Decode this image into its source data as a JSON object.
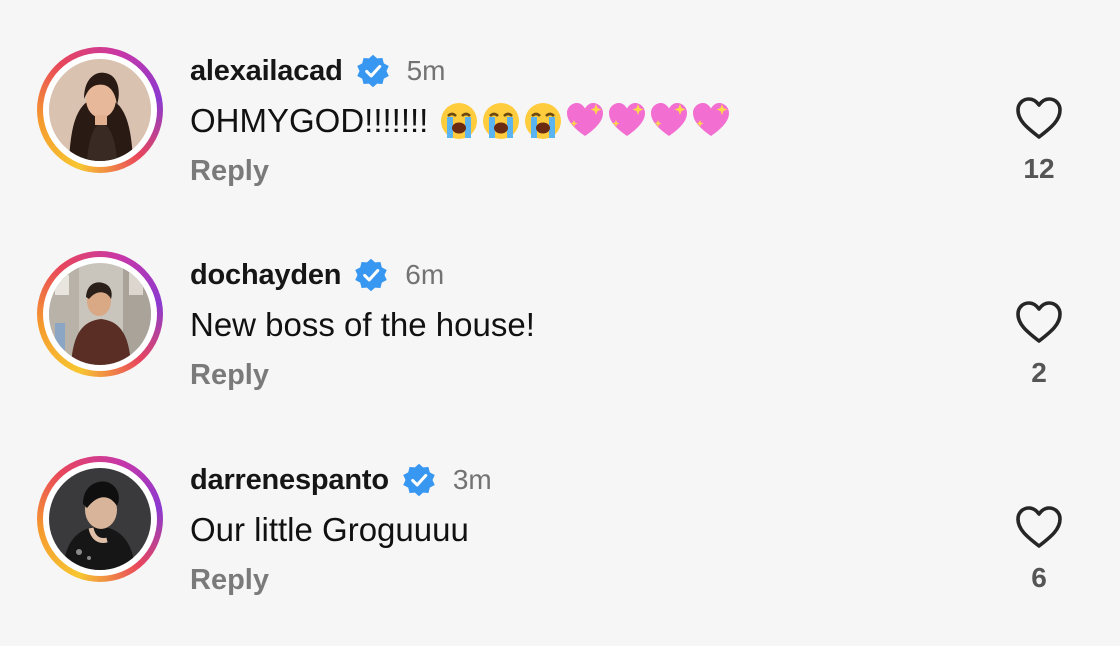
{
  "comments": [
    {
      "username": "alexailacad",
      "time": "5m",
      "text": "OHMYGOD!!!!!!!",
      "emojis": [
        "loudly-crying-face",
        "loudly-crying-face",
        "loudly-crying-face",
        "sparkling-heart",
        "sparkling-heart",
        "sparkling-heart",
        "sparkling-heart"
      ],
      "reply_label": "Reply",
      "like_count": "12"
    },
    {
      "username": "dochayden",
      "time": "6m",
      "text": "New boss of the house!",
      "reply_label": "Reply",
      "like_count": "2"
    },
    {
      "username": "darrenespanto",
      "time": "3m",
      "text": "Our little Groguuuu",
      "reply_label": "Reply",
      "like_count": "6"
    }
  ],
  "colors": {
    "verified": "#3897f0",
    "muted_text": "#737373",
    "reply_text": "#7a7a7a",
    "heart_stroke": "#262626"
  },
  "icons": {
    "verified": "verified-badge-icon",
    "like": "heart-outline-icon"
  }
}
